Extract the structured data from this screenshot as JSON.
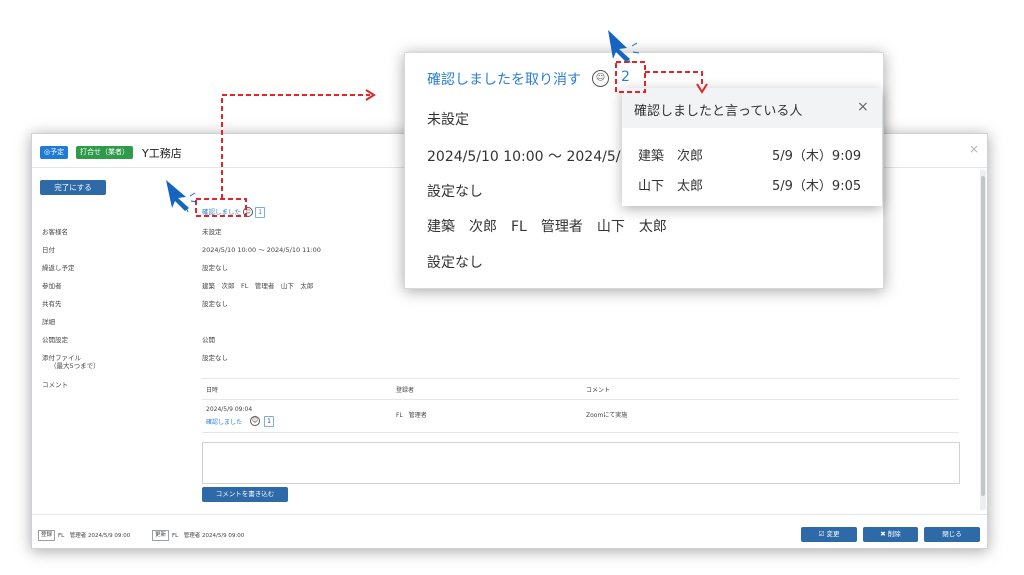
{
  "modal": {
    "badge_yotei": "◎予定",
    "badge_kind": "打合せ（業者）",
    "title": "Y工務店",
    "close_icon": "×",
    "complete_button": "完了にする",
    "confirm_link": "確認しました",
    "confirm_count": "1",
    "fields": [
      {
        "label": "お客様名",
        "value": "未設定"
      },
      {
        "label": "日付",
        "value": "2024/5/10 10:00 〜 2024/5/10 11:00"
      },
      {
        "label": "繰返し予定",
        "value": "設定なし"
      },
      {
        "label": "参加者",
        "value": "建築　次郎　FL　管理者　山下　太郎"
      },
      {
        "label": "共有先",
        "value": "設定なし"
      },
      {
        "label": "詳細",
        "value": ""
      },
      {
        "label": "公開設定",
        "value": "公開"
      },
      {
        "label": "添付ファイル",
        "label2": "（最大5つまで）",
        "value": "設定なし"
      },
      {
        "label": "コメント",
        "value": ""
      }
    ],
    "comments": {
      "headers": [
        "日時",
        "登録者",
        "コメント"
      ],
      "rows": [
        {
          "datetime": "2024/5/9 09:04",
          "confirm": "確認しました",
          "count": "1",
          "author": "FL　管理者",
          "comment": "Zoomにて実施"
        }
      ]
    },
    "write_button": "コメントを書き込む",
    "footer": {
      "reg_tag": "登録",
      "reg_text": "FL　管理者 2024/5/9 09:00",
      "upd_tag": "更新",
      "upd_text": "FL　管理者 2024/5/9 09:00",
      "edit_button": "☑ 変更",
      "delete_button": "✖ 削除",
      "close_button": "閉じる"
    }
  },
  "zoom": {
    "link": "確認しましたを取り消す",
    "count": "2",
    "lines": [
      "未設定",
      "2024/5/10 10:00 〜 2024/5/10",
      "設定なし",
      "建築　次郎　FL　管理者　山下　太郎",
      "設定なし"
    ]
  },
  "popover": {
    "title": "確認しましたと言っている人",
    "close": "×",
    "people": [
      {
        "name": "建築　次郎",
        "time": "5/9（木）9:09"
      },
      {
        "name": "山下　太郎",
        "time": "5/9（木）9:05"
      }
    ]
  },
  "colors": {
    "accent": "#2e6aa8",
    "link": "#2a7fd4",
    "callout": "#e0262a",
    "pointer": "#1565c0"
  }
}
